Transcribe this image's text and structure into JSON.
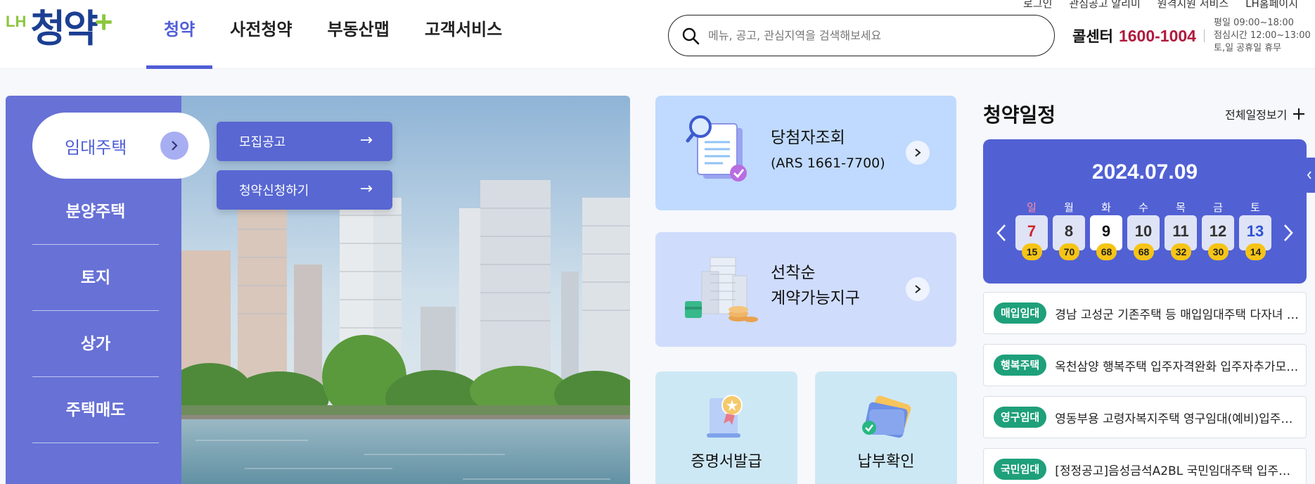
{
  "header": {
    "util_links": [
      "로그인",
      "관심공고 알리미",
      "원격지원 서비스",
      "LH홈페이지"
    ],
    "logo": {
      "prefix": "LH",
      "name": "청약",
      "suffix": "+"
    },
    "gnb": [
      {
        "label": "청약",
        "active": true
      },
      {
        "label": "사전청약",
        "active": false
      },
      {
        "label": "부동산맵",
        "active": false
      },
      {
        "label": "고객서비스",
        "active": false
      }
    ],
    "search": {
      "placeholder": "메뉴, 공고, 관심지역을 검색해보세요",
      "value": ""
    },
    "callcenter": {
      "label": "콜센터",
      "number": "1600-1004"
    },
    "hours": [
      "평일 09:00~18:00",
      "점심시간 12:00~13:00",
      "토,일 공휴일 휴무"
    ]
  },
  "leftnav": {
    "active": "임대주택",
    "items": [
      "분양주택",
      "토지",
      "상가",
      "주택매도"
    ]
  },
  "hero": {
    "submenu": [
      "모집공고",
      "청약신청하기"
    ],
    "submenu_arrow": "→"
  },
  "cards": {
    "winner": {
      "title": "당첨자조회",
      "sub": "(ARS 1661-7700)"
    },
    "first_come": {
      "title_line1": "선착순",
      "title_line2": "계약가능지구"
    },
    "certificate": {
      "title": "증명서발급"
    },
    "payment": {
      "title": "납부확인"
    }
  },
  "schedule": {
    "title": "청약일정",
    "view_all": "전체일정보기",
    "date": "2024.07.09",
    "days": [
      {
        "weekday": "일",
        "day": "7",
        "count": "15",
        "kind": "sun"
      },
      {
        "weekday": "월",
        "day": "8",
        "count": "70",
        "kind": ""
      },
      {
        "weekday": "화",
        "day": "9",
        "count": "68",
        "kind": "today"
      },
      {
        "weekday": "수",
        "day": "10",
        "count": "68",
        "kind": ""
      },
      {
        "weekday": "목",
        "day": "11",
        "count": "32",
        "kind": ""
      },
      {
        "weekday": "금",
        "day": "12",
        "count": "30",
        "kind": ""
      },
      {
        "weekday": "토",
        "day": "13",
        "count": "14",
        "kind": "sat"
      }
    ],
    "notices": [
      {
        "tag": "매입임대",
        "text": "경남 고성군 기존주택 등 매입임대주택 다자녀 …"
      },
      {
        "tag": "행복주택",
        "text": "옥천삼양 행복주택 입주자격완화 입주자추가모…"
      },
      {
        "tag": "영구임대",
        "text": "영동부용 고령자복지주택 영구임대(예비)입주…"
      },
      {
        "tag": "국민임대",
        "text": "[정정공고]음성금석A2BL 국민임대주택 입주…"
      }
    ]
  },
  "colors": {
    "brand_blue": "#4f5ed6",
    "nav_purple": "#6771d6",
    "call_red": "#b01a3c",
    "tag_green": "#1ea07a",
    "count_yellow": "#f6c416"
  }
}
